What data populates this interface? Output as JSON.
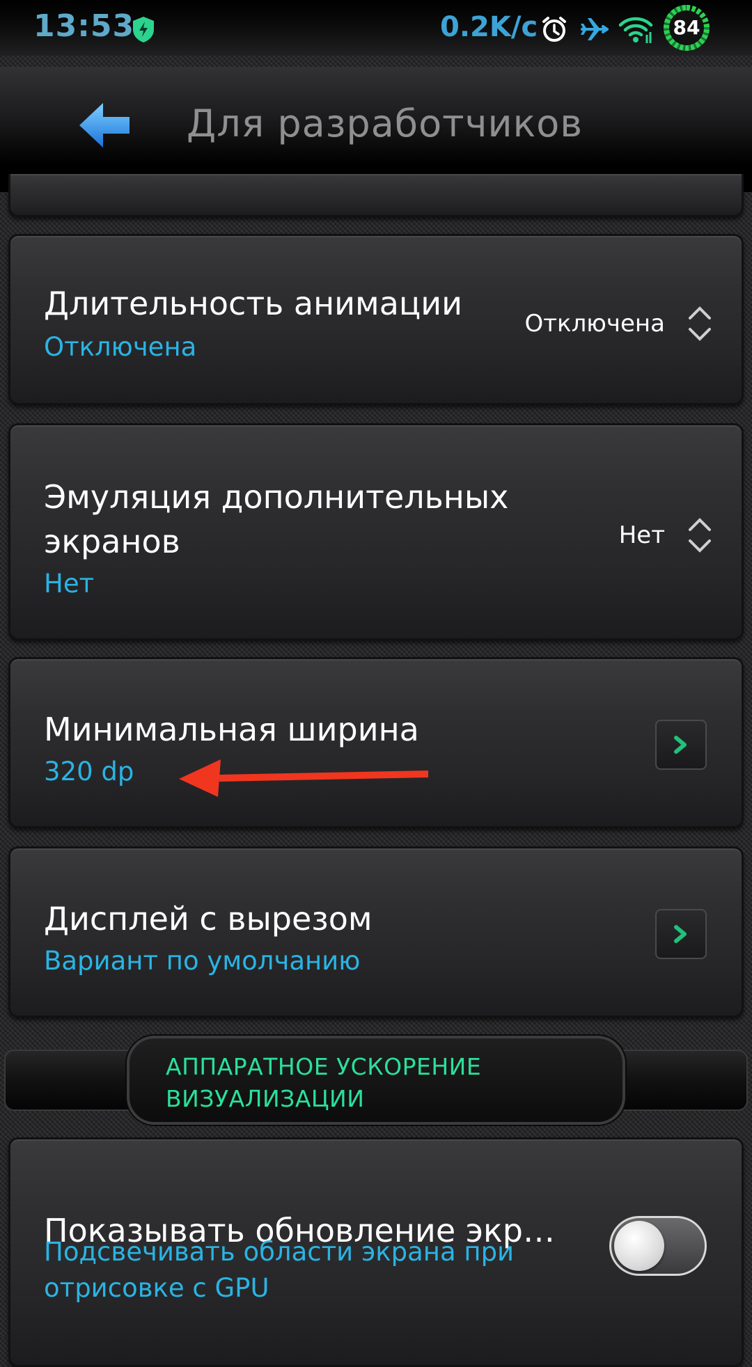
{
  "status_bar": {
    "time": "13:53",
    "network_speed": "0.2K/c",
    "battery_level": "84",
    "icons": [
      "shield-icon",
      "alarm-icon",
      "airplane-icon",
      "wifi-icon",
      "battery-ring-icon"
    ],
    "time_color": "#5fa9c9",
    "accent_color": "#3da3d6"
  },
  "header": {
    "title": "Для разработчиков",
    "back_icon": "back-arrow-icon"
  },
  "settings": {
    "animation_duration": {
      "title": "Длительность анимации",
      "subtitle": "Отключена",
      "value": "Отключена"
    },
    "secondary_displays": {
      "title_line1": "Эмуляция дополнительных",
      "title_line2": "экранов",
      "subtitle": "Нет",
      "value": "Нет"
    },
    "smallest_width": {
      "title": "Минимальная ширина",
      "subtitle": "320 dp"
    },
    "display_cutout": {
      "title": "Дисплей с вырезом",
      "subtitle": "Вариант по умолчанию"
    }
  },
  "section": {
    "title_line1": "АППАРАТНОЕ УСКОРЕНИЕ",
    "title_line2": "ВИЗУАЛИЗАЦИИ"
  },
  "show_surface_updates": {
    "title": "Показывать обновление экр…",
    "subtitle_line1": "Подсвечивать области экрана при",
    "subtitle_line2": "отрисовке с GPU",
    "enabled": false
  },
  "colors": {
    "subtitle": "#2ab4e4",
    "section_title": "#2be09a",
    "annotation_arrow": "#f0361f",
    "nav_chevron": "#22c07a"
  }
}
